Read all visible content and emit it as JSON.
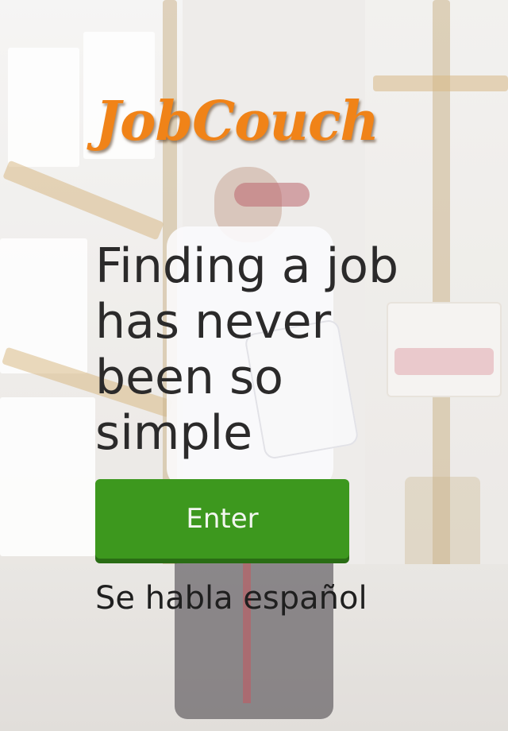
{
  "app": {
    "logo_text": "JobCouch"
  },
  "main": {
    "headline": "Finding a job has never been so simple",
    "enter_label": "Enter",
    "language_link": "Se habla español"
  },
  "colors": {
    "logo_orange": "#f08318",
    "button_green": "#3d981e",
    "headline_text": "#2b2a2a"
  },
  "background": {
    "description_icon": "warehouse-workers-photo"
  }
}
